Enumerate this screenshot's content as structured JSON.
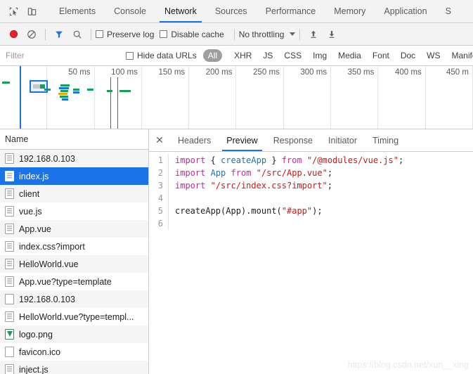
{
  "tabbar": {
    "inspect_icon": "inspect-cursor-icon",
    "device_icon": "device-toolbar-icon",
    "tabs": [
      {
        "label": "Elements",
        "active": false
      },
      {
        "label": "Console",
        "active": false
      },
      {
        "label": "Network",
        "active": true
      },
      {
        "label": "Sources",
        "active": false
      },
      {
        "label": "Performance",
        "active": false
      },
      {
        "label": "Memory",
        "active": false
      },
      {
        "label": "Application",
        "active": false
      },
      {
        "label": "S",
        "active": false
      }
    ]
  },
  "controls": {
    "record_title": "record-button",
    "clear_title": "clear-button",
    "filter_title": "filter-toggle",
    "search_title": "search-button",
    "preserve_log_label": "Preserve log",
    "disable_cache_label": "Disable cache",
    "throttling_value": "No throttling",
    "import_har_title": "import-har",
    "export_har_title": "export-har",
    "accent": "#1a73e8",
    "record_color": "#e3252a"
  },
  "filterbar": {
    "placeholder": "Filter",
    "value": "",
    "hide_data_urls_label": "Hide data URLs",
    "types": [
      {
        "label": "All",
        "selected": true
      },
      {
        "label": "XHR",
        "selected": false
      },
      {
        "label": "JS",
        "selected": false
      },
      {
        "label": "CSS",
        "selected": false
      },
      {
        "label": "Img",
        "selected": false
      },
      {
        "label": "Media",
        "selected": false
      },
      {
        "label": "Font",
        "selected": false
      },
      {
        "label": "Doc",
        "selected": false
      },
      {
        "label": "WS",
        "selected": false
      },
      {
        "label": "Manife",
        "selected": false
      }
    ]
  },
  "overview": {
    "ticks": [
      "50 ms",
      "100 ms",
      "150 ms",
      "200 ms",
      "250 ms",
      "300 ms",
      "350 ms",
      "400 ms",
      "450 m"
    ],
    "dom_content_loaded_color": "#1a73e8",
    "load_color": "#d93025"
  },
  "requests": {
    "column_header": "Name",
    "rows": [
      {
        "name": "192.168.0.103",
        "icon": "script-file-icon",
        "selected": false
      },
      {
        "name": "index.js",
        "icon": "script-file-icon",
        "selected": true
      },
      {
        "name": "client",
        "icon": "script-file-icon",
        "selected": false
      },
      {
        "name": "vue.js",
        "icon": "script-file-icon",
        "selected": false
      },
      {
        "name": "App.vue",
        "icon": "script-file-icon",
        "selected": false
      },
      {
        "name": "index.css?import",
        "icon": "script-file-icon",
        "selected": false
      },
      {
        "name": "HelloWorld.vue",
        "icon": "script-file-icon",
        "selected": false
      },
      {
        "name": "App.vue?type=template",
        "icon": "script-file-icon",
        "selected": false
      },
      {
        "name": "192.168.0.103",
        "icon": "blank-file-icon",
        "selected": false
      },
      {
        "name": "HelloWorld.vue?type=templ...",
        "icon": "script-file-icon",
        "selected": false
      },
      {
        "name": "logo.png",
        "icon": "image-file-icon",
        "selected": false
      },
      {
        "name": "favicon.ico",
        "icon": "blank-file-icon",
        "selected": false
      },
      {
        "name": "inject.js",
        "icon": "script-file-icon",
        "selected": false
      }
    ]
  },
  "detail": {
    "close_label": "✕",
    "tabs": [
      {
        "label": "Headers",
        "active": false
      },
      {
        "label": "Preview",
        "active": true
      },
      {
        "label": "Response",
        "active": false
      },
      {
        "label": "Initiator",
        "active": false
      },
      {
        "label": "Timing",
        "active": false
      }
    ],
    "code_lines": [
      {
        "n": "1",
        "tokens": [
          {
            "t": "import",
            "c": "kw"
          },
          {
            "t": " ",
            "c": "pl"
          },
          {
            "t": "{",
            "c": "pl"
          },
          {
            "t": " ",
            "c": "pl"
          },
          {
            "t": "createApp",
            "c": "id"
          },
          {
            "t": " ",
            "c": "pl"
          },
          {
            "t": "}",
            "c": "pl"
          },
          {
            "t": " ",
            "c": "pl"
          },
          {
            "t": "from",
            "c": "kw"
          },
          {
            "t": " ",
            "c": "pl"
          },
          {
            "t": "\"/@modules/vue.js\"",
            "c": "str"
          },
          {
            "t": ";",
            "c": "pl"
          }
        ]
      },
      {
        "n": "2",
        "tokens": [
          {
            "t": "import",
            "c": "kw"
          },
          {
            "t": " ",
            "c": "pl"
          },
          {
            "t": "App",
            "c": "id"
          },
          {
            "t": " ",
            "c": "pl"
          },
          {
            "t": "from",
            "c": "kw"
          },
          {
            "t": " ",
            "c": "pl"
          },
          {
            "t": "\"/src/App.vue\"",
            "c": "str"
          },
          {
            "t": ";",
            "c": "pl"
          }
        ]
      },
      {
        "n": "3",
        "tokens": [
          {
            "t": "import",
            "c": "kw"
          },
          {
            "t": " ",
            "c": "pl"
          },
          {
            "t": "\"/src/index.css?import\"",
            "c": "str"
          },
          {
            "t": ";",
            "c": "pl"
          }
        ]
      },
      {
        "n": "4",
        "tokens": []
      },
      {
        "n": "5",
        "tokens": [
          {
            "t": "createApp",
            "c": "fn"
          },
          {
            "t": "(",
            "c": "pl"
          },
          {
            "t": "App",
            "c": "pl"
          },
          {
            "t": ")",
            "c": "pl"
          },
          {
            "t": ".",
            "c": "pl"
          },
          {
            "t": "mount",
            "c": "pl"
          },
          {
            "t": "(",
            "c": "pl"
          },
          {
            "t": "\"#app\"",
            "c": "str"
          },
          {
            "t": ")",
            "c": "pl"
          },
          {
            "t": ";",
            "c": "pl"
          }
        ]
      },
      {
        "n": "6",
        "tokens": []
      }
    ]
  },
  "watermark": "https://blog.csdn.net/xun__xing"
}
